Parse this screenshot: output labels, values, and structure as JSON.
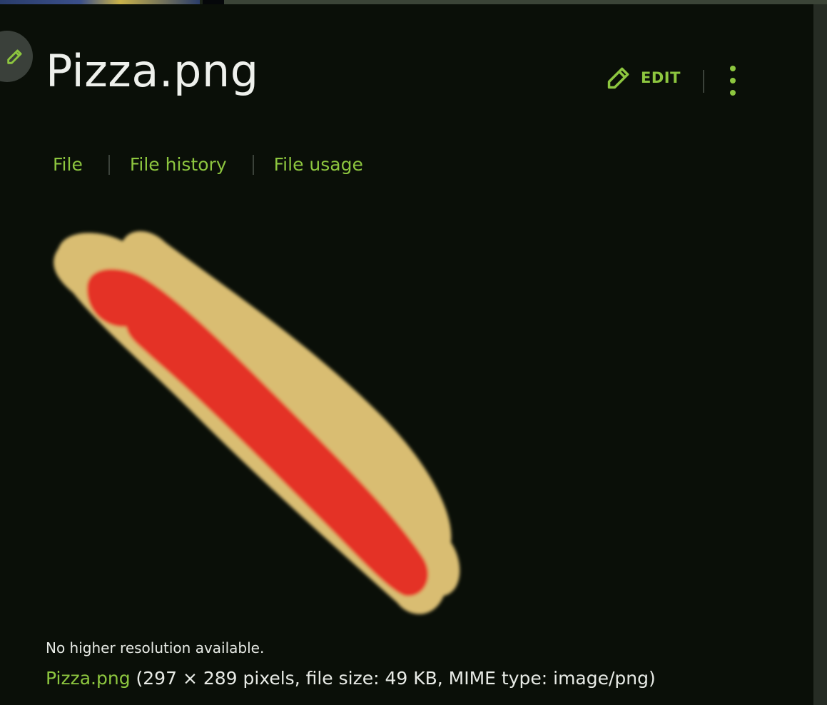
{
  "page": {
    "title": "Pizza.png"
  },
  "header": {
    "edit_label": "EDIT",
    "edit_icon": "pencil-icon",
    "more_icon": "vertical-ellipsis-icon",
    "fab_icon": "pencil-icon"
  },
  "tabs": [
    {
      "label": "File"
    },
    {
      "label": "File history"
    },
    {
      "label": "File usage"
    }
  ],
  "image": {
    "alt": "Pizza.png",
    "crust_color": "#d9bd72",
    "sauce_color": "#e43226"
  },
  "footer": {
    "no_higher_res": "No higher resolution available.",
    "file_link": "Pizza.png",
    "file_details": " (297 × 289 pixels, file size: 49 KB, MIME type: image/png)"
  },
  "colors": {
    "accent": "#8dc63f",
    "background": "#0a0f08",
    "text": "#eef0ec"
  }
}
